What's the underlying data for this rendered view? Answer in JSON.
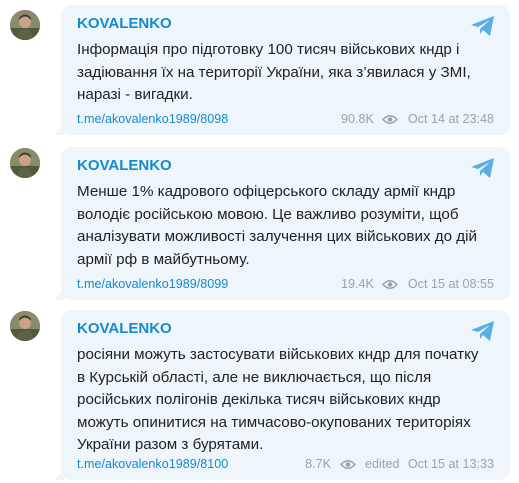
{
  "posts": [
    {
      "author": "KOVALENKO",
      "text": "Інформація про підготовку 100 тисяч військових кндр і задіювання їх на території України, яка з’явилася у ЗМІ, наразі - вигадки.",
      "link": "t.me/akovalenko1989/8098",
      "views": "90.8K",
      "edited": "",
      "date": "Oct 14 at 23:48"
    },
    {
      "author": "KOVALENKO",
      "text": "Менше 1% кадрового офіцерського складу армії кндр володіє російською мовою. Це важливо розуміти, щоб аналізувати можливості залучення цих військових до дій армії рф в майбутньому.",
      "link": "t.me/akovalenko1989/8099",
      "views": "19.4K",
      "edited": "",
      "date": "Oct 15 at 08:55"
    },
    {
      "author": "KOVALENKO",
      "text": "росіяни можуть застосувати військових кндр для початку в Курській області, але не виключається, що після російських полігонів декілька тисяч військових кндр можуть опинитися на тимчасово-окупованих територіях України разом з бурятами.",
      "link": "t.me/akovalenko1989/8100",
      "views": "8.7K",
      "edited": "edited",
      "date": "Oct 15 at 13:33"
    }
  ],
  "icons": {
    "channel_icon": "telegram-plane-icon",
    "views_icon": "eye-icon",
    "avatar": "soldier-avatar"
  },
  "colors": {
    "accent": "#168acd",
    "bubble": "#eef6fb",
    "text": "#222222",
    "meta": "#9aa3ab"
  }
}
